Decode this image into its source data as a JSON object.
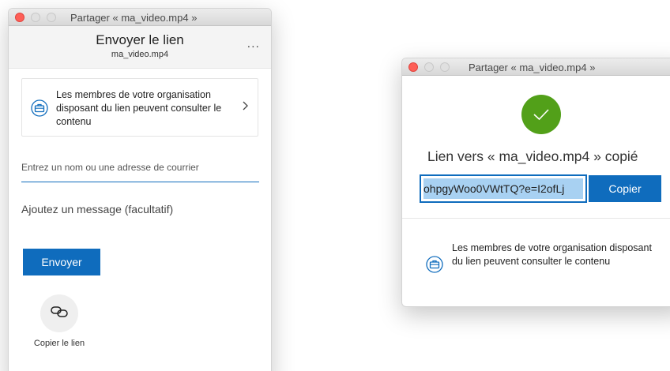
{
  "window1": {
    "title": "Partager « ma_video.mp4 »",
    "header_title": "Envoyer le lien",
    "header_subtitle": "ma_video.mp4",
    "more_label": "...",
    "permission_text": "Les membres de votre organisation disposant du lien peuvent consulter le contenu",
    "email_placeholder": "Entrez un nom ou une adresse de courrier",
    "message_placeholder": "Ajoutez un message (facultatif)",
    "send_label": "Envoyer",
    "copy_link_label": "Copier le lien"
  },
  "window2": {
    "title": "Partager « ma_video.mp4 »",
    "copied_text": "Lien vers « ma_video.mp4 » copié",
    "link_value": "ohpgyWoo0VWtTQ?e=I2ofLj",
    "copy_label": "Copier",
    "permission_text": "Les membres de votre organisation disposant du lien peuvent consulter le contenu"
  },
  "colors": {
    "accent": "#0f6cbd",
    "success": "#52a019",
    "close": "#fe5f57"
  }
}
